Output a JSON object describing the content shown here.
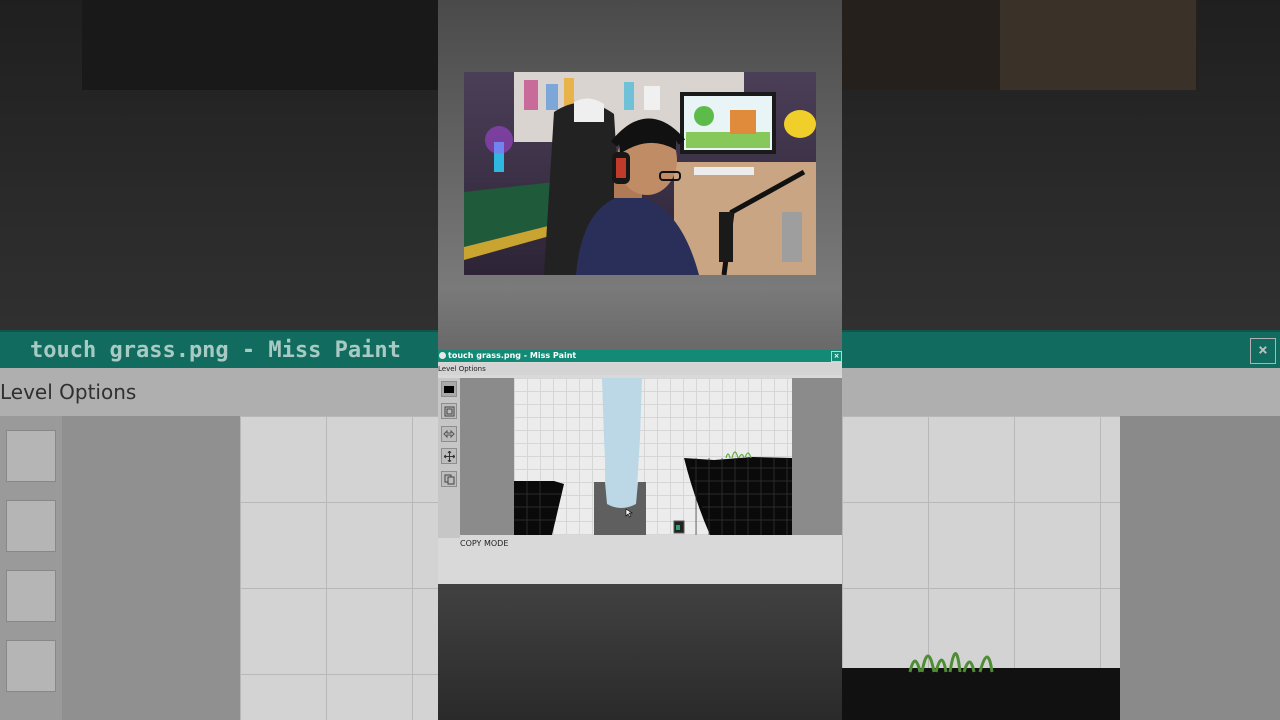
{
  "window": {
    "title": "touch grass.png - Miss Paint",
    "close_glyph": "×"
  },
  "menu": {
    "items": [
      "Level",
      "Options"
    ],
    "label": "Level  Options"
  },
  "tools": [
    {
      "icon": "rectangle-fill-icon"
    },
    {
      "icon": "select-box-icon"
    },
    {
      "icon": "flip-arrows-icon"
    },
    {
      "icon": "move-icon"
    },
    {
      "icon": "copy-icon"
    }
  ],
  "status": {
    "mode_label": "COPY MODE"
  },
  "colors": {
    "titlebar": "#138a75",
    "waterfall": "#bcd7e6",
    "grass": "#5fae3d",
    "terrain": "#0a0a0a"
  }
}
